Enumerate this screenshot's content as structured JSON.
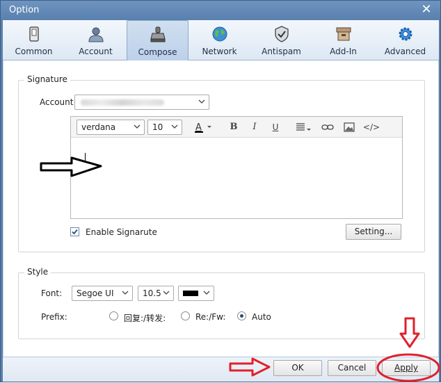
{
  "window": {
    "title": "Option"
  },
  "toolbar": {
    "items": [
      {
        "label": "Common",
        "icon": "phone-icon"
      },
      {
        "label": "Account",
        "icon": "user-icon"
      },
      {
        "label": "Compose",
        "icon": "stamp-icon"
      },
      {
        "label": "Network",
        "icon": "globe-icon"
      },
      {
        "label": "Antispam",
        "icon": "shield-icon"
      },
      {
        "label": "Add-In",
        "icon": "box-icon"
      },
      {
        "label": "Advanced",
        "icon": "gear-icon"
      }
    ],
    "active": "Compose"
  },
  "signature": {
    "group_title": "Signature",
    "account_label": "Account",
    "editor": {
      "font": "verdana",
      "size": "10",
      "bold": "B",
      "italic": "I",
      "underline": "U",
      "source": "</>"
    },
    "enable_label": "Enable Signarute",
    "enable_checked": true,
    "setting_button": "Setting..."
  },
  "style": {
    "group_title": "Style",
    "font_label": "Font:",
    "font_value": "Segoe UI",
    "size_value": "10.5",
    "color_value": "#000000",
    "prefix_label": "Prefix:",
    "prefix_options": [
      "回复:/转发:",
      "Re:/Fw:",
      "Auto"
    ],
    "prefix_selected": "Auto"
  },
  "footer": {
    "ok": "OK",
    "cancel": "Cancel",
    "apply": "Apply"
  },
  "colors": {
    "title_bar": "#5b7fa9",
    "annotation": "#e0202a"
  }
}
